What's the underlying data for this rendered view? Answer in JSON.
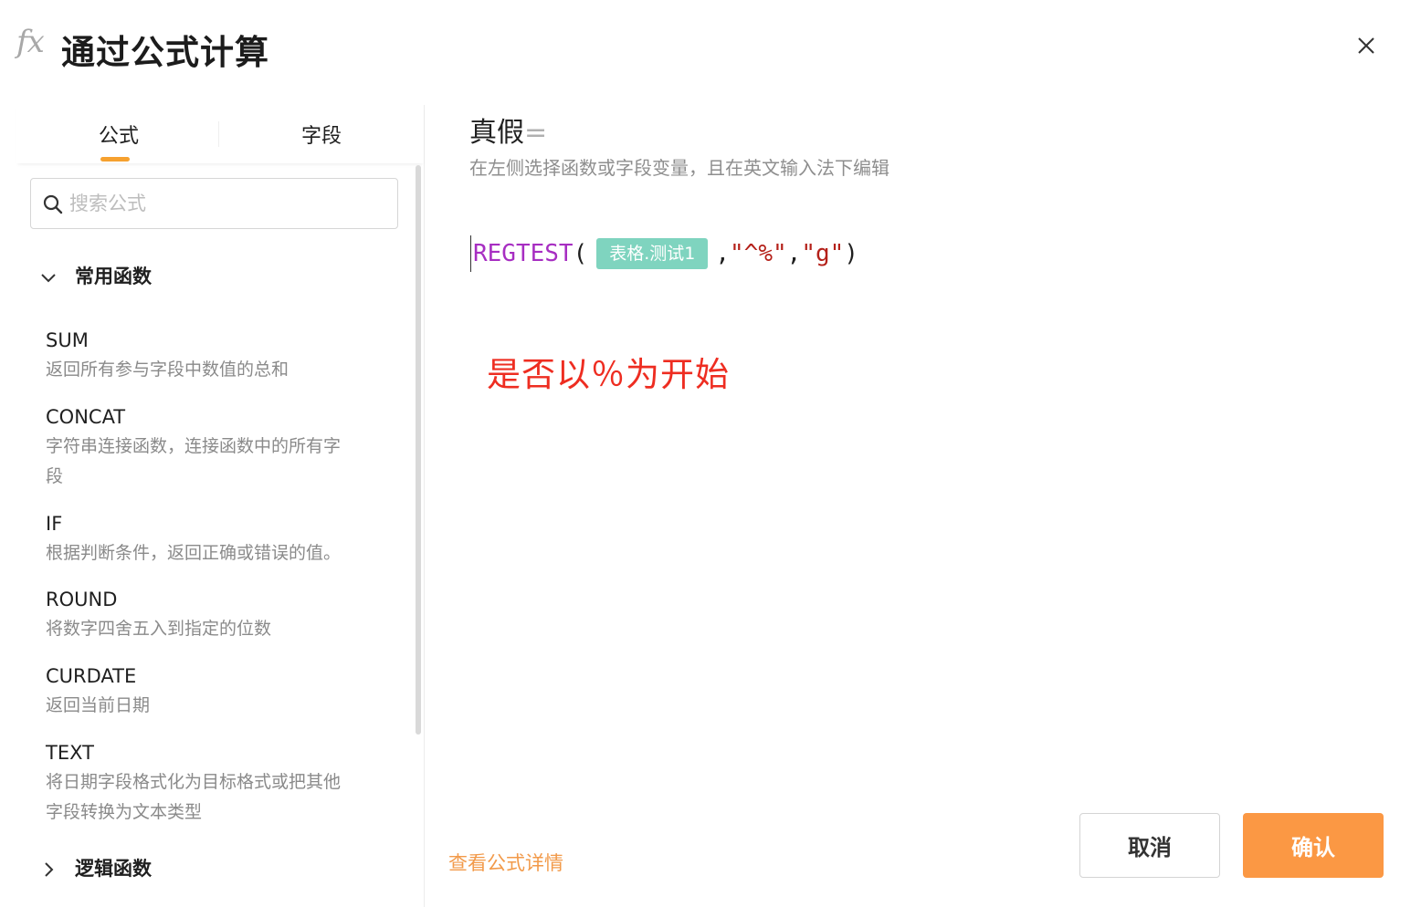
{
  "header": {
    "icon_text": "fx",
    "title": "通过公式计算"
  },
  "tabs": [
    {
      "label": "公式",
      "active": true
    },
    {
      "label": "字段",
      "active": false
    }
  ],
  "search": {
    "placeholder": "搜索公式",
    "value": ""
  },
  "groups": {
    "common": {
      "label": "常用函数",
      "expanded": true
    },
    "logic": {
      "label": "逻辑函数",
      "expanded": false
    }
  },
  "functions": [
    {
      "name": "SUM",
      "desc": [
        "返回所有参与字段中数值的总和"
      ]
    },
    {
      "name": "CONCAT",
      "desc": [
        "字符串连接函数，连接函数中的所有字",
        "段"
      ]
    },
    {
      "name": "IF",
      "desc": [
        "根据判断条件，返回正确或错误的值。"
      ]
    },
    {
      "name": "ROUND",
      "desc": [
        "将数字四舍五入到指定的位数"
      ]
    },
    {
      "name": "CURDATE",
      "desc": [
        "返回当前日期"
      ]
    },
    {
      "name": "TEXT",
      "desc": [
        "将日期字段格式化为目标格式或把其他",
        "字段转换为文本类型"
      ]
    }
  ],
  "editor": {
    "field_name": "真假",
    "equals": "=",
    "hint": "在左侧选择函数或字段变量，且在英文输入法下编辑",
    "fn": "REGTEST",
    "open_paren": "(",
    "variable": "表格.测试1",
    "comma1": ",",
    "arg2": "\"^%\"",
    "comma2": ",",
    "arg3": "\"g\"",
    "close_paren": ")"
  },
  "annotation": "是否以％为开始",
  "footer": {
    "detail_link": "查看公式详情",
    "cancel_label": "取消",
    "confirm_label": "确认"
  },
  "colors": {
    "accent": "#fb9844",
    "tab_indicator": "#f6a12f",
    "function_token": "#a72ec2",
    "string_token": "#b42019",
    "variable_tag": "#7fd4bf",
    "annotation": "#ee2d21"
  },
  "icons": [
    "fx-icon",
    "close-icon",
    "search-icon",
    "chevron-down-icon",
    "chevron-right-icon"
  ]
}
